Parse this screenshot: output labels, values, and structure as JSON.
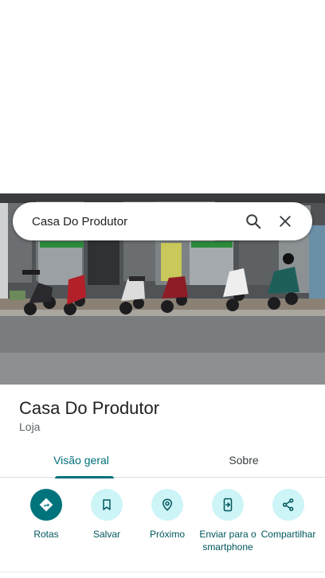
{
  "search": {
    "query": "Casa Do Produtor"
  },
  "place": {
    "title": "Casa Do Produtor",
    "category": "Loja"
  },
  "tabs": [
    {
      "label": "Visão geral",
      "active": true
    },
    {
      "label": "Sobre",
      "active": false
    }
  ],
  "actions": [
    {
      "label": "Rotas",
      "icon": "directions-icon"
    },
    {
      "label": "Salvar",
      "icon": "bookmark-icon"
    },
    {
      "label": "Próximo",
      "icon": "nearby-icon"
    },
    {
      "label": "Enviar para o smartphone",
      "icon": "send-to-phone-icon"
    },
    {
      "label": "Compartilhar",
      "icon": "share-icon"
    }
  ],
  "colors": {
    "accent": "#00707a",
    "action_bg": "#cdf4f7",
    "primary_action_bg": "#00737c"
  }
}
